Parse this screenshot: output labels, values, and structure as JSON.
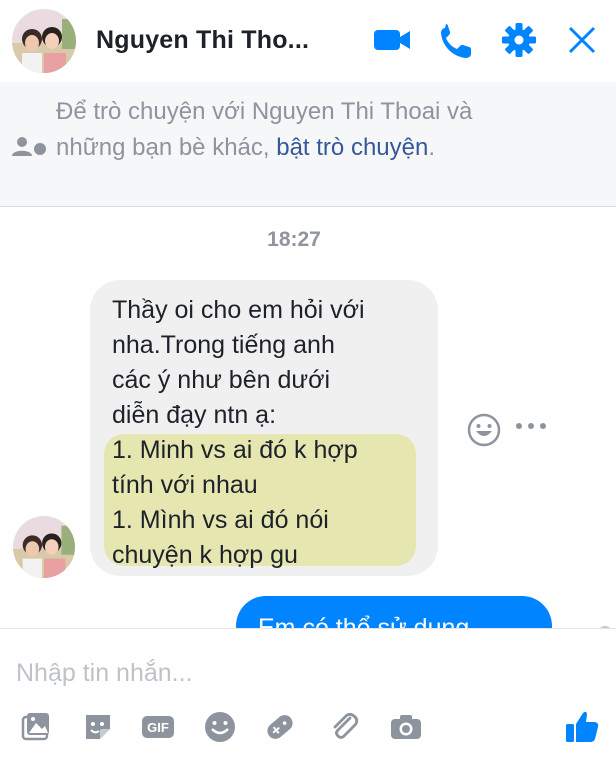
{
  "header": {
    "name": "Nguyen Thi Tho..."
  },
  "notice": {
    "prefix": "Để trò chuyện với Nguyen Thi Thoai và những bạn bè khác, ",
    "link": "bật trò chuyện",
    "suffix": "."
  },
  "messages": {
    "time": "18:27",
    "incoming_lines": [
      "Thầy oi cho em hỏi với",
      "nha.Trong tiếng anh",
      "các ý như bên dưới",
      "diễn đạy ntn ạ:",
      "1. Minh vs ai đó k hợp",
      "tính với nhau",
      "1. Mình vs ai đó nói",
      "chuyện k hợp gu"
    ],
    "outgoing": "Em có thể sử dụng"
  },
  "composer": {
    "placeholder": "Nhập tin nhắn..."
  },
  "colors": {
    "accent": "#0084ff",
    "bubble_in": "#f1f0f0",
    "highlight": "#e6e6b0"
  }
}
